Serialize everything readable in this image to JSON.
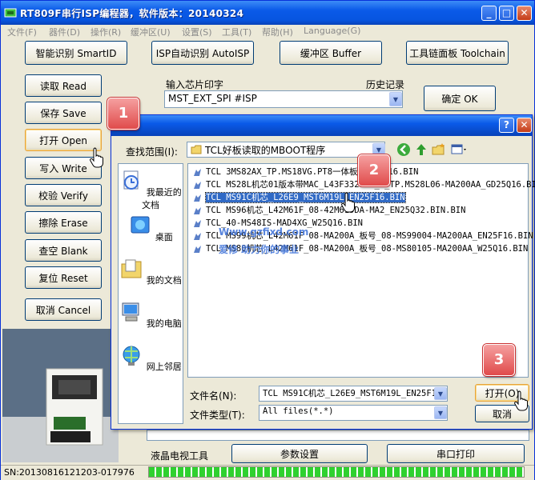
{
  "window": {
    "title": "RT809F串行ISP编程器，软件版本：20140324",
    "controls": {
      "minimize": "_",
      "maximize": "□",
      "close": "✕"
    }
  },
  "menu": [
    {
      "label": "文件(F)"
    },
    {
      "label": "器件(D)"
    },
    {
      "label": "操作(R)"
    },
    {
      "label": "缓冲区(U)"
    },
    {
      "label": "设置(S)"
    },
    {
      "label": "工具(T)"
    },
    {
      "label": "帮助(H)"
    },
    {
      "label": "Language(G)"
    }
  ],
  "toolbar": {
    "smart_id": "智能识别 SmartID",
    "auto_isp": "ISP自动识别 AutoISP",
    "buffer": "缓冲区 Buffer",
    "toolchain": "工具链面板 Toolchain"
  },
  "chip": {
    "label": "输入芯片印字",
    "value": "MST_EXT_SPI #ISP",
    "history_label": "历史记录",
    "ok": "确定 OK"
  },
  "side_buttons": [
    {
      "label": "读取 Read"
    },
    {
      "label": "保存 Save"
    },
    {
      "label": "打开 Open"
    },
    {
      "label": "写入 Write"
    },
    {
      "label": "校验 Verify"
    },
    {
      "label": "擦除 Erase"
    },
    {
      "label": "查空 Blank"
    },
    {
      "label": "复位 Reset"
    },
    {
      "label": "取消 Cancel"
    }
  ],
  "bottom": {
    "tv_tools": "液晶电视工具",
    "params": "参数设置",
    "serial_print": "串口打印"
  },
  "status": {
    "sn": "SN:20130816121203-017976"
  },
  "dialog": {
    "help": "?",
    "close": "✕",
    "lookin_label": "查找范围(I):",
    "lookin_value": "TCL好板读取的MBOOT程序",
    "places": [
      {
        "label": "我最近的文档",
        "icon": "recent-documents-icon"
      },
      {
        "label": "桌面",
        "icon": "desktop-icon"
      },
      {
        "label": "我的文档",
        "icon": "my-documents-icon"
      },
      {
        "label": "我的电脑",
        "icon": "my-computer-icon"
      },
      {
        "label": "网上邻居",
        "icon": "network-places-icon"
      }
    ],
    "files": [
      "TCL 3MS82AX_TP.MS18VG.PT8一体板_GD25Q16.BIN",
      "TCL MS28L机芯01版本带MAC_L43F3320-E_S_TP.MS28L06-MA200AA_GD25Q16.BIN",
      "TCL MS91C机芯_L26E9_MST6M19L_EN25F16.BIN",
      "TCL MS96机芯_L42M61F_08-42M615DA-MA2_EN25Q32.BIN.BIN",
      "TCL_40-MS48IS-MAD4XG_W25Q16.BIN",
      "TCL MS99机芯_L42M61F_08-MA200A_板号_08-MS99004-MA200AA_EN25F16.BIN",
      "TCL MS80机芯_L42M61F_08-MA200A_板号_08-MS80105-MA200AA_W25Q16.BIN"
    ],
    "selected_index": 2,
    "watermark1": "Www.gzfixd.com",
    "watermark2": "爱修  助力你的事业",
    "filename_label": "文件名(N):",
    "filename_value": "TCL MS91C机芯_L26E9_MST6M19L_EN25F16.BIN",
    "filetype_label": "文件类型(T):",
    "filetype_value": "All files(*.*)",
    "open": "打开(O)",
    "cancel": "取消"
  },
  "callouts": [
    "1",
    "2",
    "3"
  ],
  "colors": {
    "xp_blue": "#0a5ae8",
    "selection": "#316ac5",
    "callout": "#e04b4b",
    "progress": "#2fd12f"
  }
}
